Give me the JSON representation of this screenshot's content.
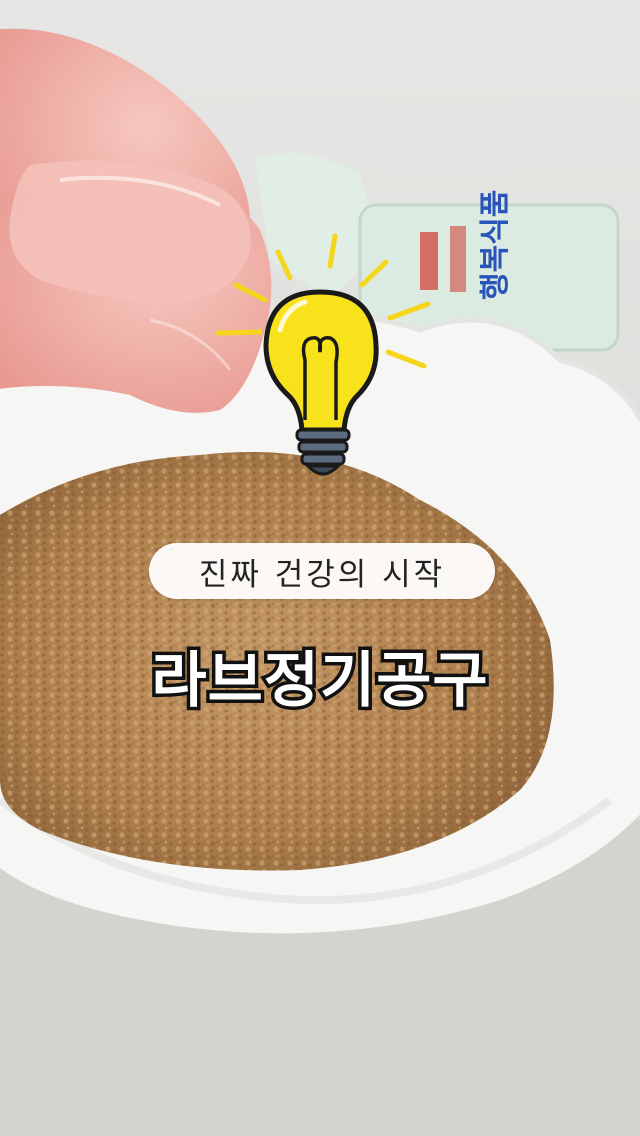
{
  "overlay": {
    "caption": "진짜 건강의 시작",
    "headline": "라브정기공구"
  },
  "background_product": {
    "label": "행복식품"
  },
  "icons": {
    "sticker": "lightbulb-icon"
  },
  "colors": {
    "bulb": "#f7e21c",
    "bulb_outline": "#1a1a1a",
    "rays": "#f5d61a",
    "powder": "#b88c5a",
    "bowl": "#f7f7f7",
    "table": "#d9d8d4"
  }
}
